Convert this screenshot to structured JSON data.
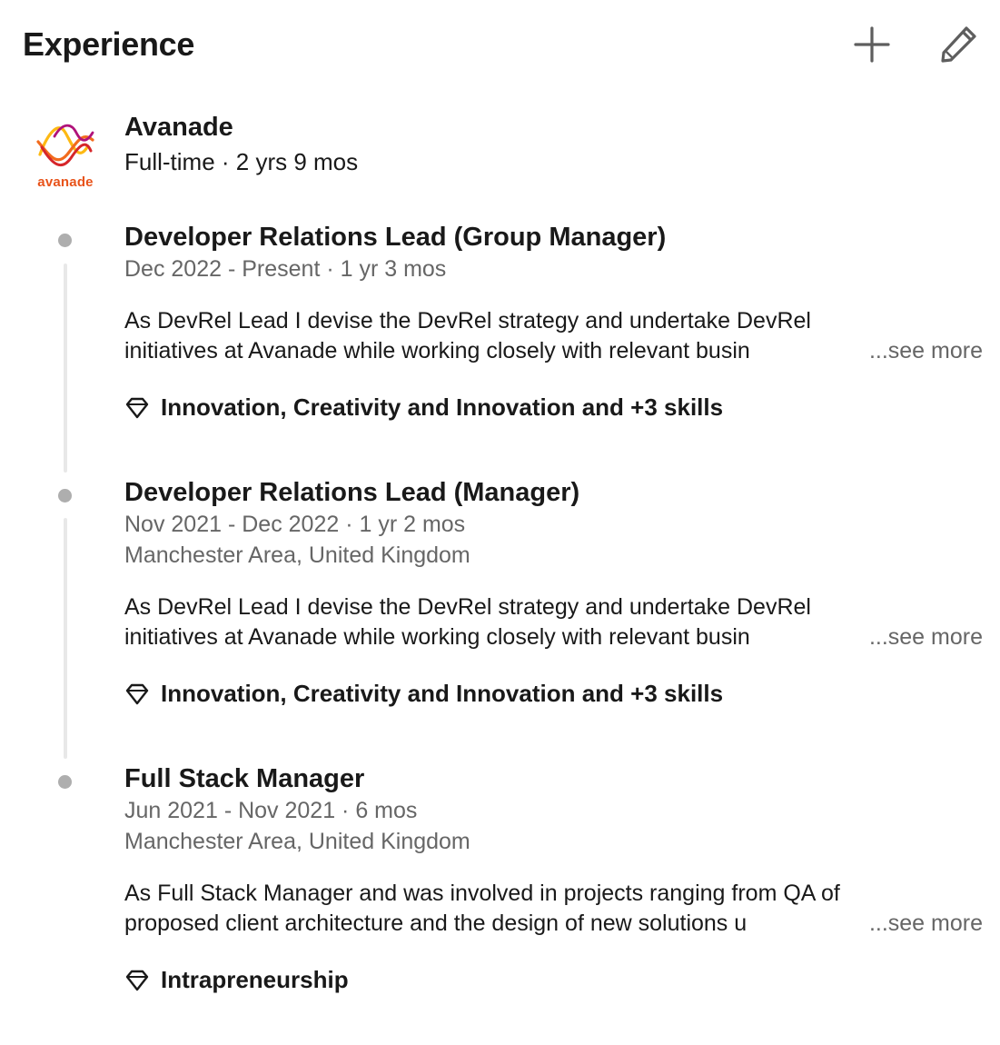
{
  "section": {
    "title": "Experience",
    "add_icon": "plus-icon",
    "edit_icon": "pencil-icon"
  },
  "company": {
    "name": "Avanade",
    "meta": "Full-time · 2 yrs 9 mos",
    "logo_text": "avanade",
    "logo_colors": {
      "orange": "#f26b1d",
      "yellow": "#fdb913",
      "red": "#d6262a",
      "magenta": "#b0127a"
    }
  },
  "positions": [
    {
      "title": "Developer Relations Lead (Group Manager)",
      "dates": "Dec 2022 - Present · 1 yr 3 mos",
      "desc_line1": "As DevRel Lead I devise the DevRel strategy and undertake DevRel",
      "desc_line2": "initiatives at Avanade while working closely with relevant busin",
      "ellipsis": "...",
      "see_more": "see more",
      "skills": "Innovation, Creativity and Innovation and +3 skills"
    },
    {
      "title": "Developer Relations Lead (Manager)",
      "dates": "Nov 2021 - Dec 2022 · 1 yr 2 mos",
      "location": "Manchester Area, United Kingdom",
      "desc_line1": "As DevRel Lead I devise the DevRel strategy and undertake DevRel",
      "desc_line2": "initiatives at Avanade while working closely with relevant busin",
      "ellipsis": "...",
      "see_more": "see more",
      "skills": "Innovation, Creativity and Innovation and +3 skills"
    },
    {
      "title": "Full Stack Manager",
      "dates": "Jun 2021 - Nov 2021 · 6 mos",
      "location": "Manchester Area, United Kingdom",
      "desc_line1": "As Full Stack Manager and was involved in projects ranging from QA of",
      "desc_line2": "proposed client architecture and the design of new solutions u",
      "ellipsis": "...",
      "see_more": "see more",
      "skills": "Intrapreneurship"
    }
  ],
  "skill_icon": "diamond-icon",
  "colors": {
    "text_primary": "#191919",
    "text_secondary": "#666666",
    "timeline_dot": "#aeaeae",
    "timeline_line": "#e8e8e8"
  }
}
